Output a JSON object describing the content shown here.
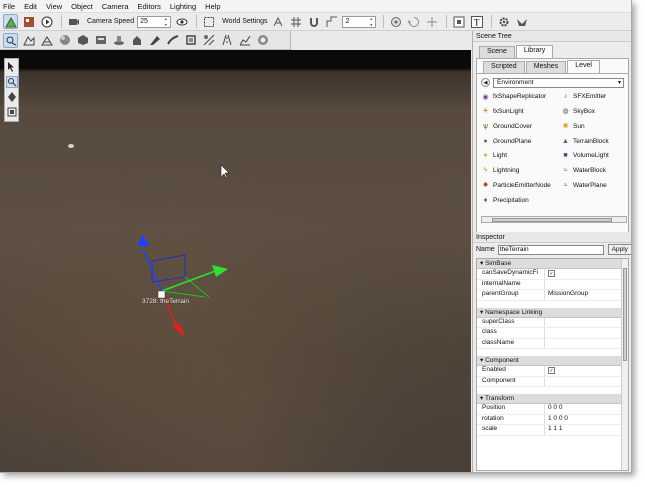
{
  "menu": [
    "File",
    "Edit",
    "View",
    "Object",
    "Camera",
    "Editors",
    "Lighting",
    "Help"
  ],
  "toolbar": {
    "camera_speed_label": "Camera Speed",
    "camera_speed_value": "25",
    "world_settings_label": "World Settings",
    "snap_value": "2"
  },
  "scene_tree": {
    "title": "Scene Tree",
    "tabs": [
      "Scene",
      "Library"
    ],
    "subtabs": [
      "Scripted",
      "Meshes",
      "Level"
    ],
    "category": "Environment",
    "items": [
      {
        "label": "fxShapeReplicator",
        "icon": "replicator-icon",
        "color": "#7a3fa0"
      },
      {
        "label": "SFXEmitter",
        "icon": "speaker-icon",
        "color": "#4a5aa0"
      },
      {
        "label": "fxSunLight",
        "icon": "sunlight-icon",
        "color": "#b07a10"
      },
      {
        "label": "SkyBox",
        "icon": "skybox-icon",
        "color": "#555"
      },
      {
        "label": "GroundCover",
        "icon": "grass-icon",
        "color": "#2e7a1e"
      },
      {
        "label": "Sun",
        "icon": "sun-icon",
        "color": "#e09a10"
      },
      {
        "label": "GroundPlane",
        "icon": "groundplane-icon",
        "color": "#3a8a3a"
      },
      {
        "label": "TerrainBlock",
        "icon": "terrain-icon",
        "color": "#6a4a9a"
      },
      {
        "label": "Light",
        "icon": "lightbulb-icon",
        "color": "#e0b020"
      },
      {
        "label": "VolumeLight",
        "icon": "volumelight-icon",
        "color": "#5a3a8a"
      },
      {
        "label": "Lightning",
        "icon": "lightning-icon",
        "color": "#e08a10"
      },
      {
        "label": "WaterBlock",
        "icon": "waterblock-icon",
        "color": "#3a6ac0"
      },
      {
        "label": "ParticleEmitterNode",
        "icon": "particle-icon",
        "color": "#c04a10"
      },
      {
        "label": "WaterPlane",
        "icon": "waterplane-icon",
        "color": "#3a6ac0"
      },
      {
        "label": "Precipitation",
        "icon": "raindrop-icon",
        "color": "#2a5ab0"
      }
    ]
  },
  "inspector": {
    "title": "Inspector",
    "name_label": "Name",
    "name_value": "theTerrain",
    "apply_label": "Apply",
    "groups": [
      {
        "title": "SimBase",
        "rows": [
          {
            "k": "canSaveDynamicFi",
            "v": "",
            "check": true
          },
          {
            "k": "internalName",
            "v": ""
          },
          {
            "k": "parentGroup",
            "v": "MissionGroup"
          }
        ]
      },
      {
        "title": "Namespace Linking",
        "rows": [
          {
            "k": "superClass",
            "v": ""
          },
          {
            "k": "class",
            "v": ""
          },
          {
            "k": "className",
            "v": ""
          }
        ]
      },
      {
        "title": "Component",
        "rows": [
          {
            "k": "Enabled",
            "v": "",
            "check": true
          },
          {
            "k": "Component",
            "v": ""
          }
        ]
      },
      {
        "title": "Transform",
        "rows": [
          {
            "k": "Position",
            "v": "0 0 0"
          },
          {
            "k": "rotation",
            "v": "1 0 0 0"
          },
          {
            "k": "scale",
            "v": "1 1 1"
          }
        ]
      }
    ]
  },
  "viewport": {
    "object_label": "3728: theTerrain"
  }
}
